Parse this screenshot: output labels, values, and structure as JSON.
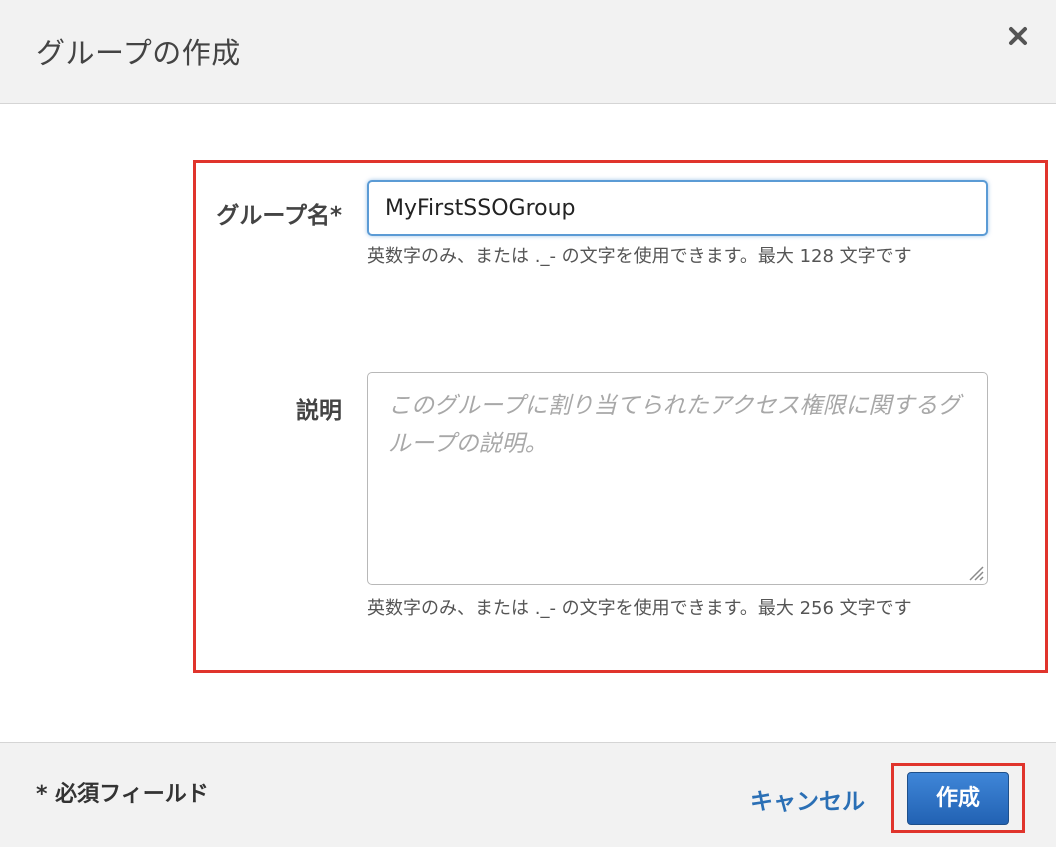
{
  "dialog": {
    "title": "グループの作成",
    "close_icon": "close-x-icon"
  },
  "form": {
    "group_name": {
      "label": "グループ名*",
      "value": "MyFirstSSOGroup",
      "hint": "英数字のみ、または ._- の文字を使用できます。最大 128 文字です"
    },
    "description": {
      "label": "説明",
      "placeholder": "このグループに割り当てられたアクセス権限に関するグループの説明。",
      "hint": "英数字のみ、または ._- の文字を使用できます。最大 256 文字です"
    }
  },
  "footer": {
    "required_note": "*  必須フィールド",
    "cancel_label": "キャンセル",
    "create_label": "作成"
  },
  "colors": {
    "highlight": "#e0342c",
    "primary_button": "#2a6fb5",
    "link": "#2a6fb5",
    "input_focus": "#5b9bd5"
  }
}
